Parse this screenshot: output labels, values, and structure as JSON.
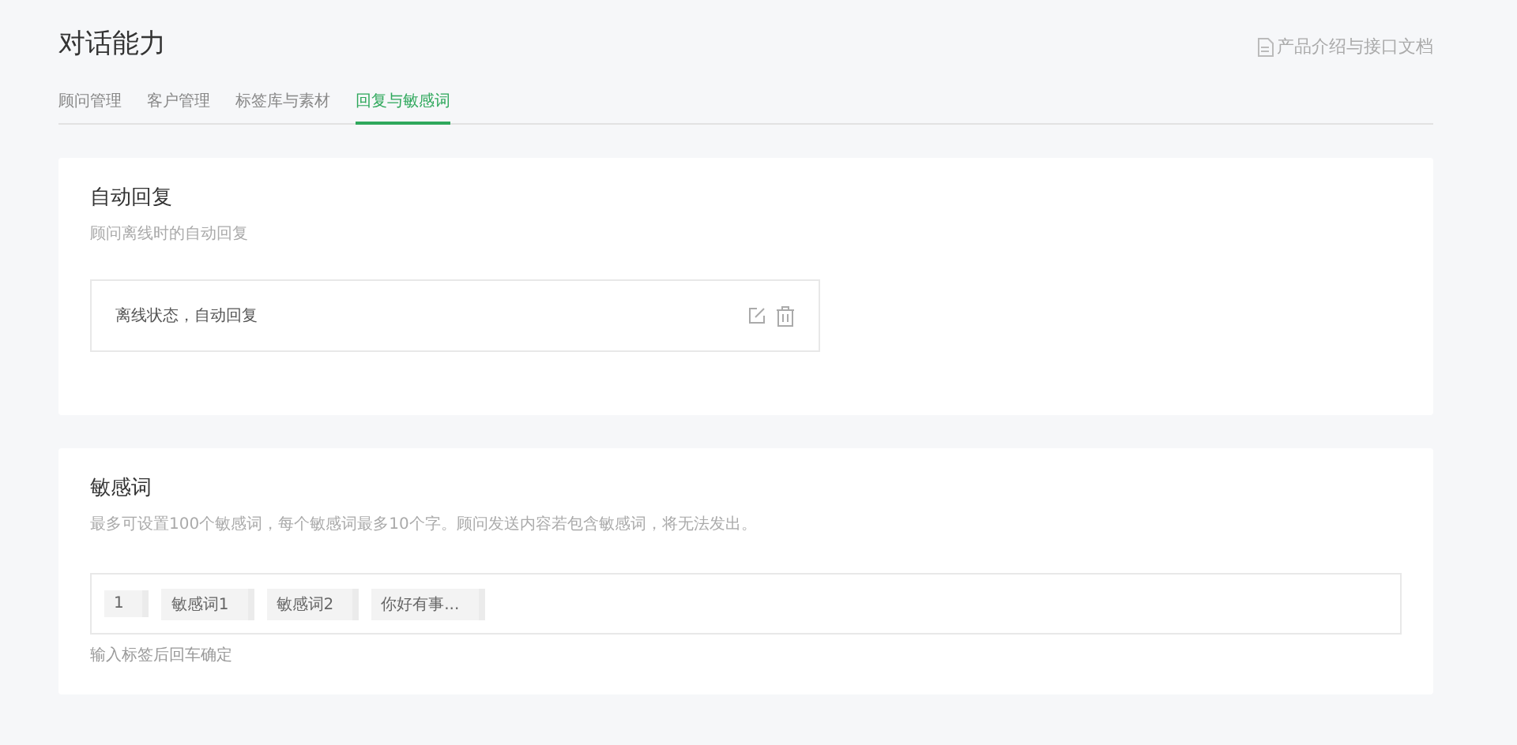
{
  "page": {
    "title": "对话能力",
    "doc_link": "产品介绍与接口文档"
  },
  "tabs": [
    {
      "label": "顾问管理",
      "selected": false
    },
    {
      "label": "客户管理",
      "selected": false
    },
    {
      "label": "标签库与素材",
      "selected": false
    },
    {
      "label": "回复与敏感词",
      "selected": true
    }
  ],
  "auto_reply": {
    "title": "自动回复",
    "description": "顾问离线时的自动回复",
    "items": [
      {
        "text": "离线状态，自动回复"
      }
    ]
  },
  "sensitive_words": {
    "title": "敏感词",
    "description": "最多可设置100个敏感词，每个敏感词最多10个字。顾问发送内容若包含敏感词，将无法发出。",
    "tags": [
      "1",
      "敏感词1",
      "敏感词2",
      "你好有事..."
    ],
    "hint": "输入标签后回车确定"
  }
}
